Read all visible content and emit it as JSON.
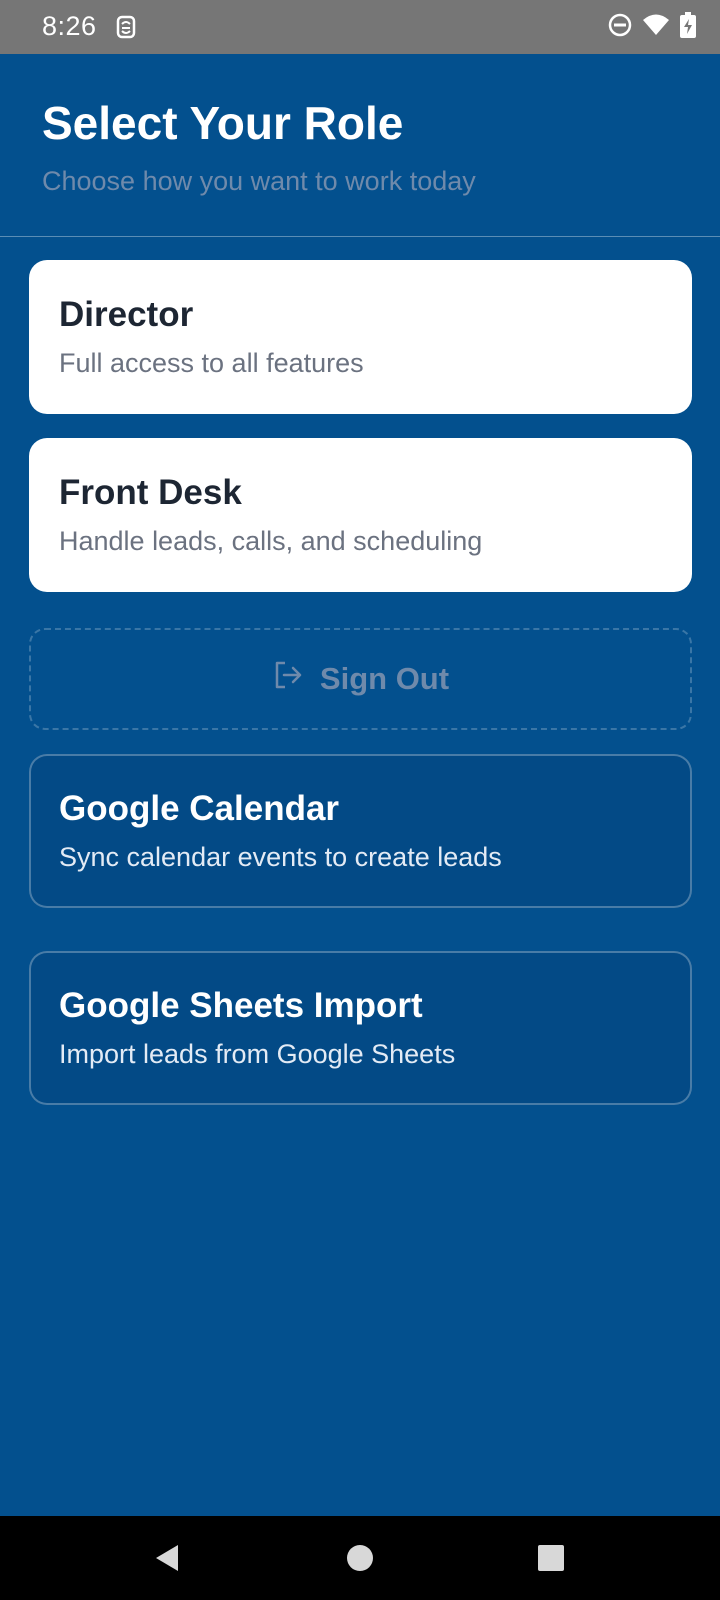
{
  "status_bar": {
    "time": "8:26",
    "icons": [
      "notification-app-icon",
      "do-not-disturb-icon",
      "wifi-icon",
      "battery-charging-icon"
    ]
  },
  "header": {
    "title": "Select Your Role",
    "subtitle": "Choose how you want to work today"
  },
  "roles": [
    {
      "title": "Director",
      "description": "Full access to all features"
    },
    {
      "title": "Front Desk",
      "description": "Handle leads, calls, and scheduling"
    }
  ],
  "sign_out": {
    "label": "Sign Out",
    "icon": "sign-out-icon"
  },
  "integrations": [
    {
      "title": "Google Calendar",
      "description": "Sync calendar events to create leads"
    },
    {
      "title": "Google Sheets Import",
      "description": "Import leads from Google Sheets"
    }
  ],
  "nav_bar": {
    "icons": [
      "back-icon",
      "home-icon",
      "recents-icon"
    ]
  },
  "colors": {
    "background": "#03508e",
    "status_bar": "#767676",
    "card_white": "#ffffff",
    "muted_text": "#6f8aab",
    "card_title_dark": "#1d2633"
  }
}
